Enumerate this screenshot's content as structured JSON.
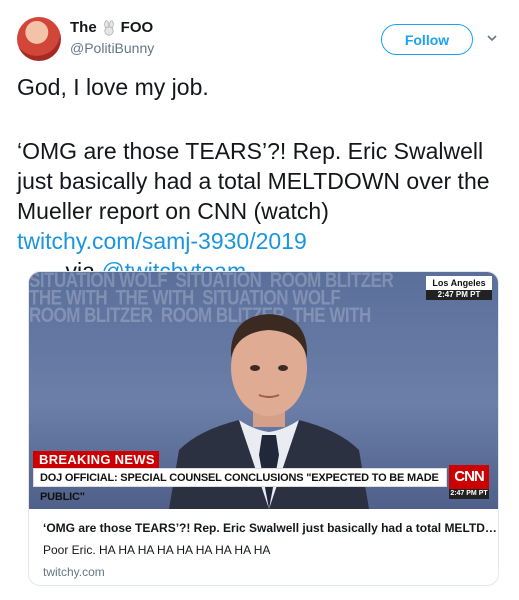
{
  "author": {
    "display_name_first": "The",
    "display_name_last": "FOO",
    "handle": "@PolitiBunny"
  },
  "follow_label": "Follow",
  "tweet": {
    "line1": "God, I love my job.",
    "body": "‘OMG are those TEARS’?! Rep. Eric Swalwell just basically had a total MELTDOWN over the Mueller report on CNN (watch) ",
    "link": "twitchy.com/samj-3930/2019",
    "after_link": "   … via ",
    "mention": "@twitchyteam"
  },
  "media": {
    "location": "Los Angeles",
    "time": "2:47 PM PT",
    "breaking": "BREAKING NEWS",
    "headline": "DOJ OFFICIAL: SPECIAL COUNSEL CONCLUSIONS \"EXPECTED TO BE MADE PUBLIC\"",
    "network": "CNN",
    "network_time": "2:47 PM PT",
    "background_text": "SITUATION WOLF  SITUATION  ROOM BLITZER\nTHE WITH  THE WITH  SITUATION WOLF\nROOM BLITZER  ROOM BLITZER  THE WITH"
  },
  "card": {
    "title": "‘OMG are those TEARS’?! Rep. Eric Swalwell just basically had a total MELTD…",
    "description": "Poor Eric. HA HA HA HA HA HA HA HA HA",
    "domain": "twitchy.com"
  }
}
